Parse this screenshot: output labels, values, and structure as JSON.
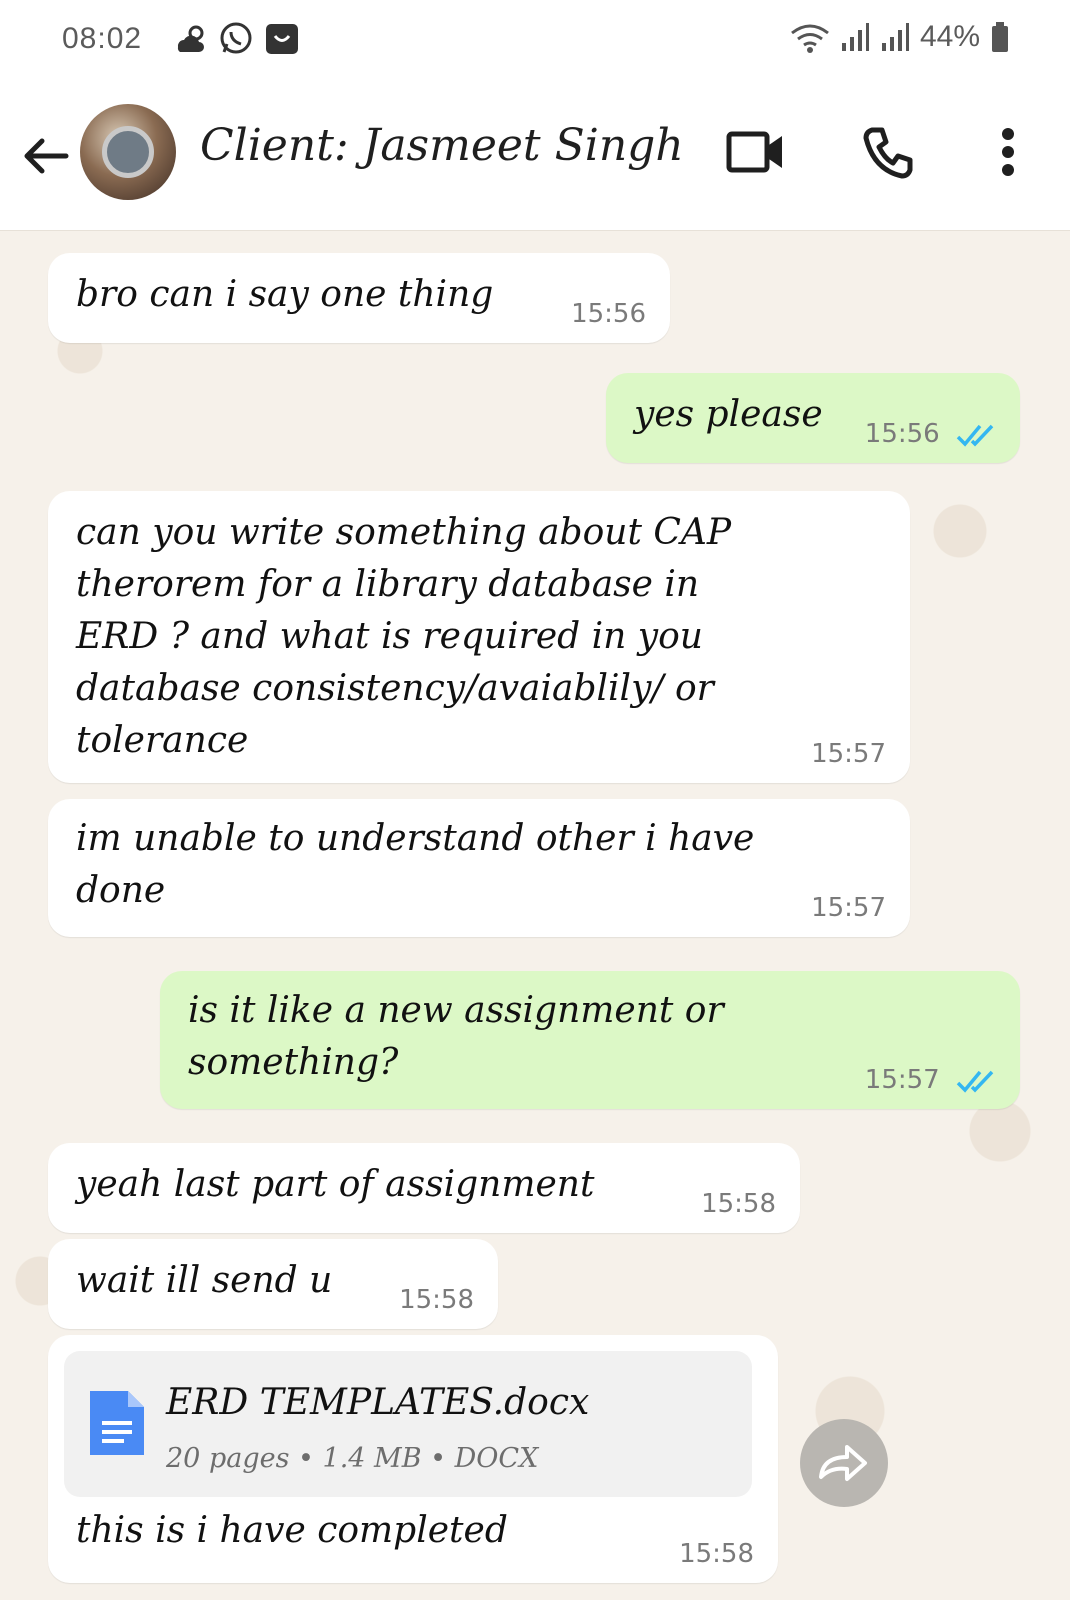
{
  "status_bar": {
    "time": "08:02",
    "battery": "44%",
    "icons": [
      "weather-icon",
      "whatsapp-icon",
      "shop-icon",
      "wifi-icon",
      "signal-icon",
      "signal-icon-2",
      "battery-icon"
    ]
  },
  "header": {
    "title": "Client: Jasmeet Singh",
    "icons": [
      "back-arrow-icon",
      "avatar",
      "video-call-icon",
      "voice-call-icon",
      "more-options-icon"
    ]
  },
  "messages": [
    {
      "direction": "incoming",
      "text": "bro can i say one thing",
      "time": "15:56"
    },
    {
      "direction": "outgoing",
      "text": "yes please",
      "time": "15:56",
      "status": "read"
    },
    {
      "direction": "incoming",
      "lines": [
        "can you write something about CAP",
        "therorem for a library database in",
        "ERD ? and what is required in you",
        "database consistency/avaiablily/ or",
        "tolerance"
      ],
      "time": "15:57"
    },
    {
      "direction": "incoming",
      "lines": [
        "im unable to understand other i have",
        "done"
      ],
      "time": "15:57"
    },
    {
      "direction": "outgoing",
      "lines": [
        "is it like a new assignment or",
        "something?"
      ],
      "time": "15:57",
      "status": "read"
    },
    {
      "direction": "incoming",
      "text": "yeah last part of assignment",
      "time": "15:58"
    },
    {
      "direction": "incoming",
      "text": "wait ill send u",
      "time": "15:58"
    },
    {
      "direction": "incoming",
      "attachment": {
        "name": "ERD TEMPLATES.docx",
        "meta": "20 pages • 1.4 MB • DOCX"
      },
      "text": "this is i have completed",
      "time": "15:58"
    }
  ],
  "colors": {
    "incoming_bubble": "#ffffff",
    "outgoing_bubble": "#dcf8c6",
    "read_ticks": "#34b7f1",
    "chat_background": "#f6f1ea",
    "doc_icon": "#4a8af4"
  }
}
